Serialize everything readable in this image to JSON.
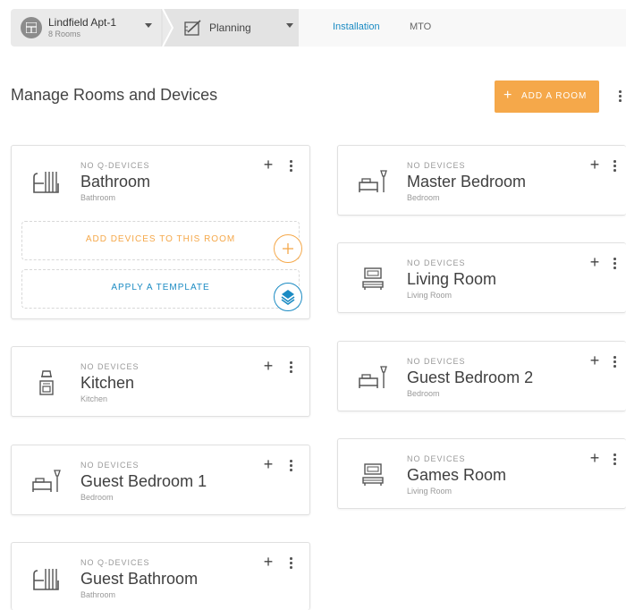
{
  "topbar": {
    "site_name": "Lindfield Apt-1",
    "site_sub": "8 Rooms",
    "stage_label": "Planning",
    "tabs": [
      {
        "label": "Installation",
        "active": true
      },
      {
        "label": "MTO",
        "active": false
      }
    ],
    "accent_color": "#1b8bc3"
  },
  "header": {
    "title": "Manage Rooms and Devices",
    "add_room_label": "ADD A ROOM",
    "add_room_icon": "+",
    "button_color": "#f5a84a"
  },
  "rooms": [
    {
      "status": "NO Q-DEVICES",
      "name": "Bathroom",
      "type": "Bathroom",
      "icon": "bathtub-icon",
      "add_devices_label": "ADD DEVICES TO THIS ROOM",
      "apply_template_label": "APPLY A TEMPLATE"
    },
    {
      "status": "NO DEVICES",
      "name": "Kitchen",
      "type": "Kitchen",
      "icon": "stove-icon"
    },
    {
      "status": "NO DEVICES",
      "name": "Guest Bedroom 1",
      "type": "Bedroom",
      "icon": "bed-icon"
    },
    {
      "status": "NO Q-DEVICES",
      "name": "Guest Bathroom",
      "type": "Bathroom",
      "icon": "bathtub-icon"
    },
    {
      "status": "NO DEVICES",
      "name": "Master Bedroom",
      "type": "Bedroom",
      "icon": "bed-icon"
    },
    {
      "status": "NO DEVICES",
      "name": "Living Room",
      "type": "Living Room",
      "icon": "sofa-tv-icon"
    },
    {
      "status": "NO DEVICES",
      "name": "Guest Bedroom 2",
      "type": "Bedroom",
      "icon": "bed-icon"
    },
    {
      "status": "NO DEVICES",
      "name": "Games Room",
      "type": "Living Room",
      "icon": "sofa-tv-icon"
    }
  ],
  "card_add_icon": "+",
  "colors": {
    "add_devices": "#f5a84a",
    "apply_template": "#1b8bc3"
  }
}
